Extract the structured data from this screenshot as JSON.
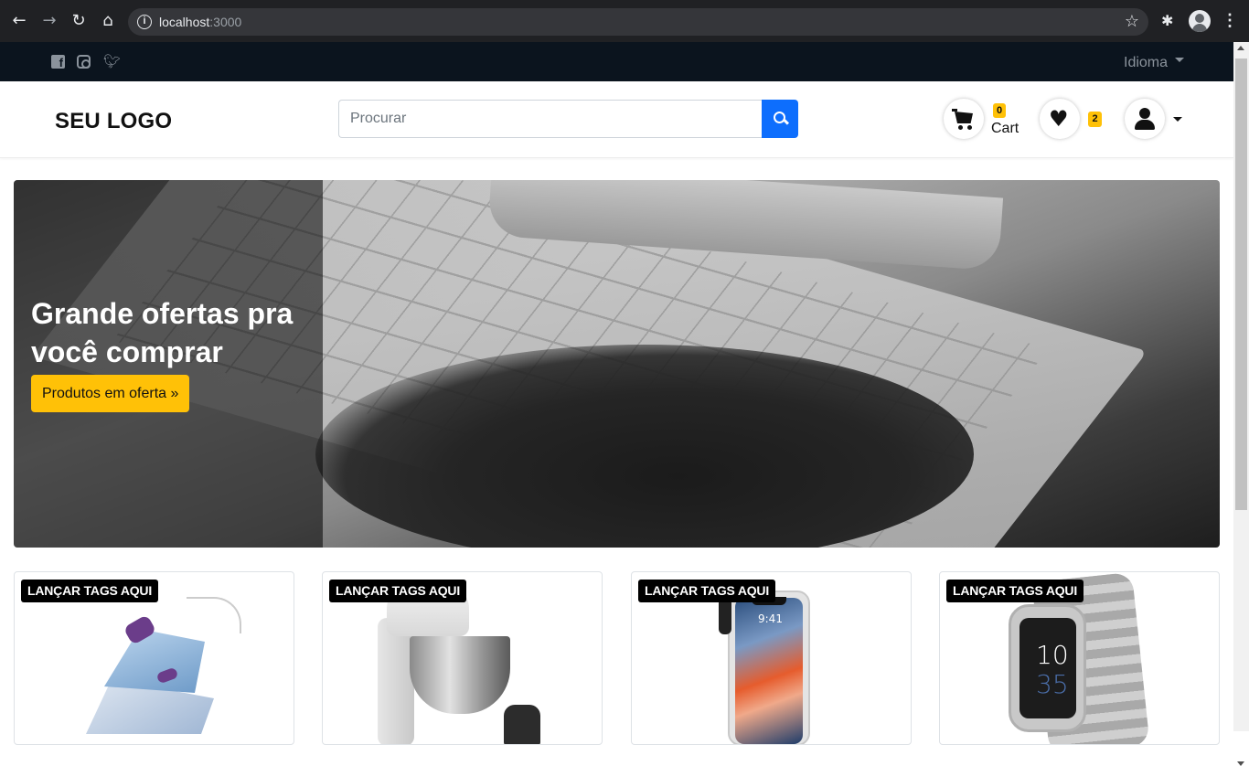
{
  "browser": {
    "url_host": "localhost",
    "url_port": ":3000",
    "info_symbol": "i",
    "icons": [
      "back-icon",
      "forward-icon",
      "reload-icon",
      "home-icon",
      "star-icon",
      "extensions-icon",
      "profile-icon",
      "menu-icon"
    ]
  },
  "topbar": {
    "social_icons": [
      "facebook-icon",
      "instagram-icon",
      "twitter-icon"
    ],
    "language_label": "Idioma"
  },
  "header": {
    "logo": "SEU LOGO",
    "search_placeholder": "Procurar",
    "cart_count": "0",
    "cart_label": "Cart",
    "wishlist_count": "2"
  },
  "hero": {
    "title": "Grande ofertas pra você comprar barato!",
    "cta_label": "Produtos em oferta »"
  },
  "products": [
    {
      "tag": "LANÇAR TAGS AQUI",
      "image": "steam-iron"
    },
    {
      "tag": "LANÇAR TAGS AQUI",
      "image": "stand-mixer"
    },
    {
      "tag": "LANÇAR TAGS AQUI",
      "image": "smartphone",
      "screen_time": "9:41"
    },
    {
      "tag": "LANÇAR TAGS AQUI",
      "image": "smartwatch",
      "watch_hour": "10",
      "watch_minute": "35"
    }
  ],
  "colors": {
    "topbar_bg": "#0b141e",
    "accent_yellow": "#ffc107",
    "search_button": "#0d6efd"
  }
}
